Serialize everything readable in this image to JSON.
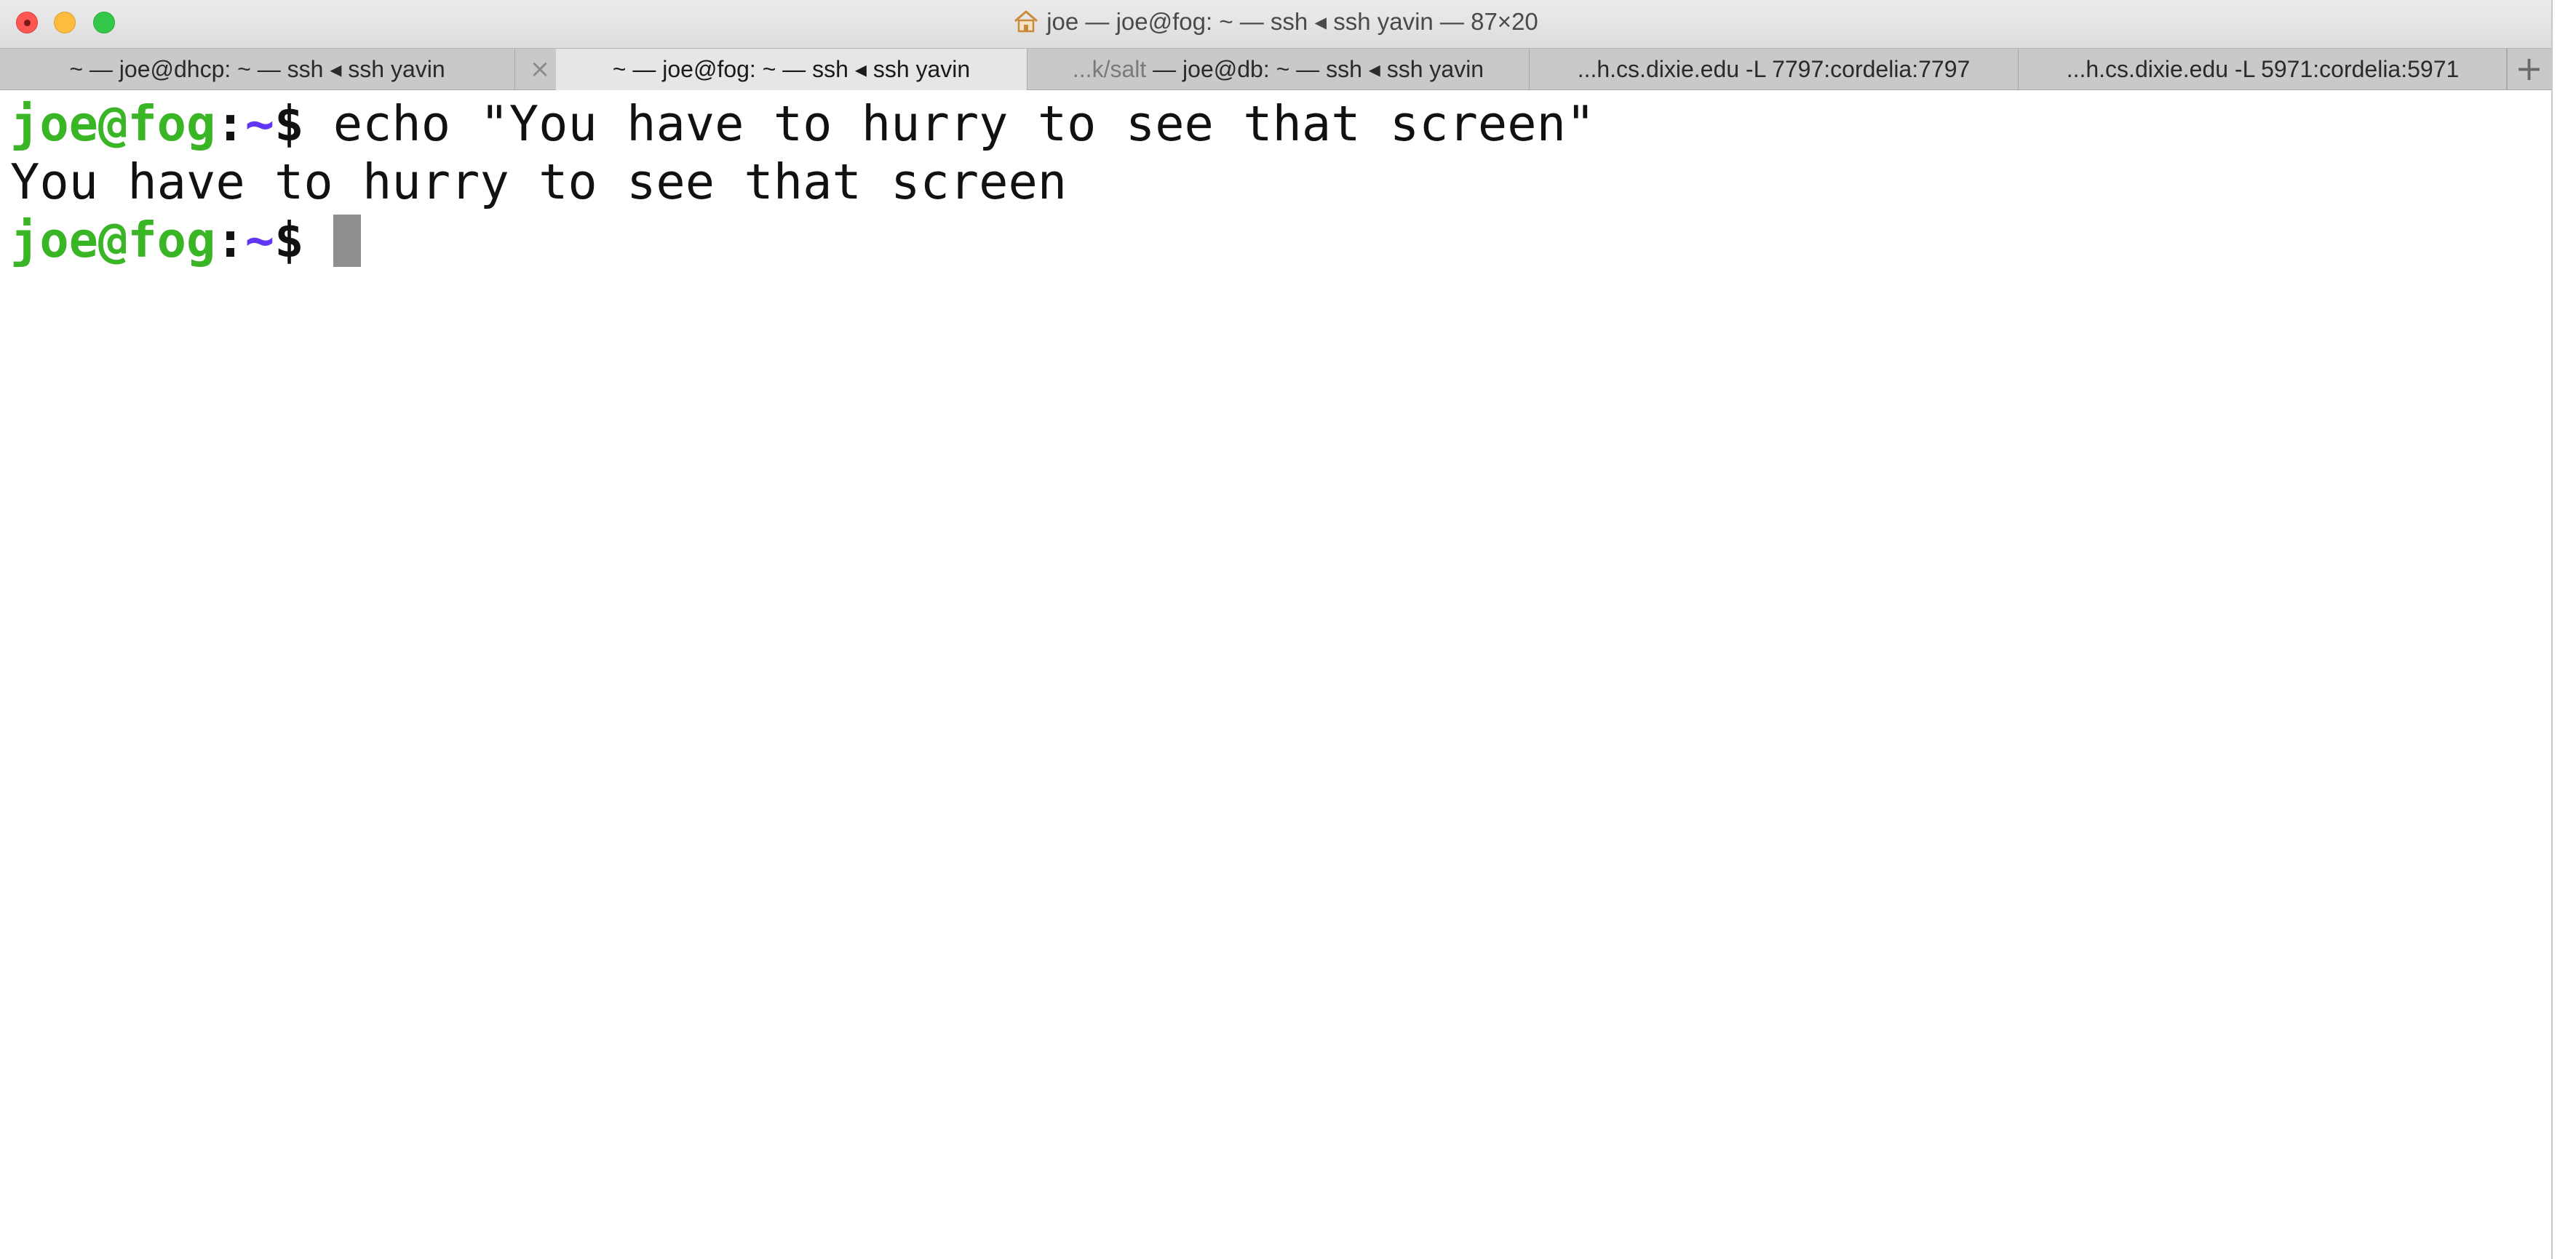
{
  "window": {
    "title": "joe — joe@fog: ~ — ssh ◂ ssh yavin — 87×20"
  },
  "tabs": [
    {
      "label": "~ — joe@dhcp: ~ — ssh ◂ ssh yavin",
      "active": false
    },
    {
      "label": "~ — joe@fog: ~ — ssh ◂ ssh yavin",
      "active": true
    },
    {
      "label_dim": "...k/salt",
      "label": " — joe@db: ~ — ssh ◂ ssh yavin",
      "active": false
    },
    {
      "label": "...h.cs.dixie.edu -L 7797:cordelia:7797",
      "active": false
    },
    {
      "label": "...h.cs.dixie.edu -L 5971:cordelia:5971",
      "active": false
    }
  ],
  "tab_close_glyph": "×",
  "new_tab_glyph": "+",
  "terminal": {
    "prompt_user": "joe@fog",
    "prompt_colon": ":",
    "prompt_path": "~",
    "prompt_dollar": "$",
    "command": "echo \"You have to hurry to see that screen\"",
    "output": "You have to hurry to see that screen"
  },
  "colors": {
    "prompt_user": "#39b525",
    "prompt_path": "#6236f2",
    "cursor": "#8f8f8f"
  }
}
